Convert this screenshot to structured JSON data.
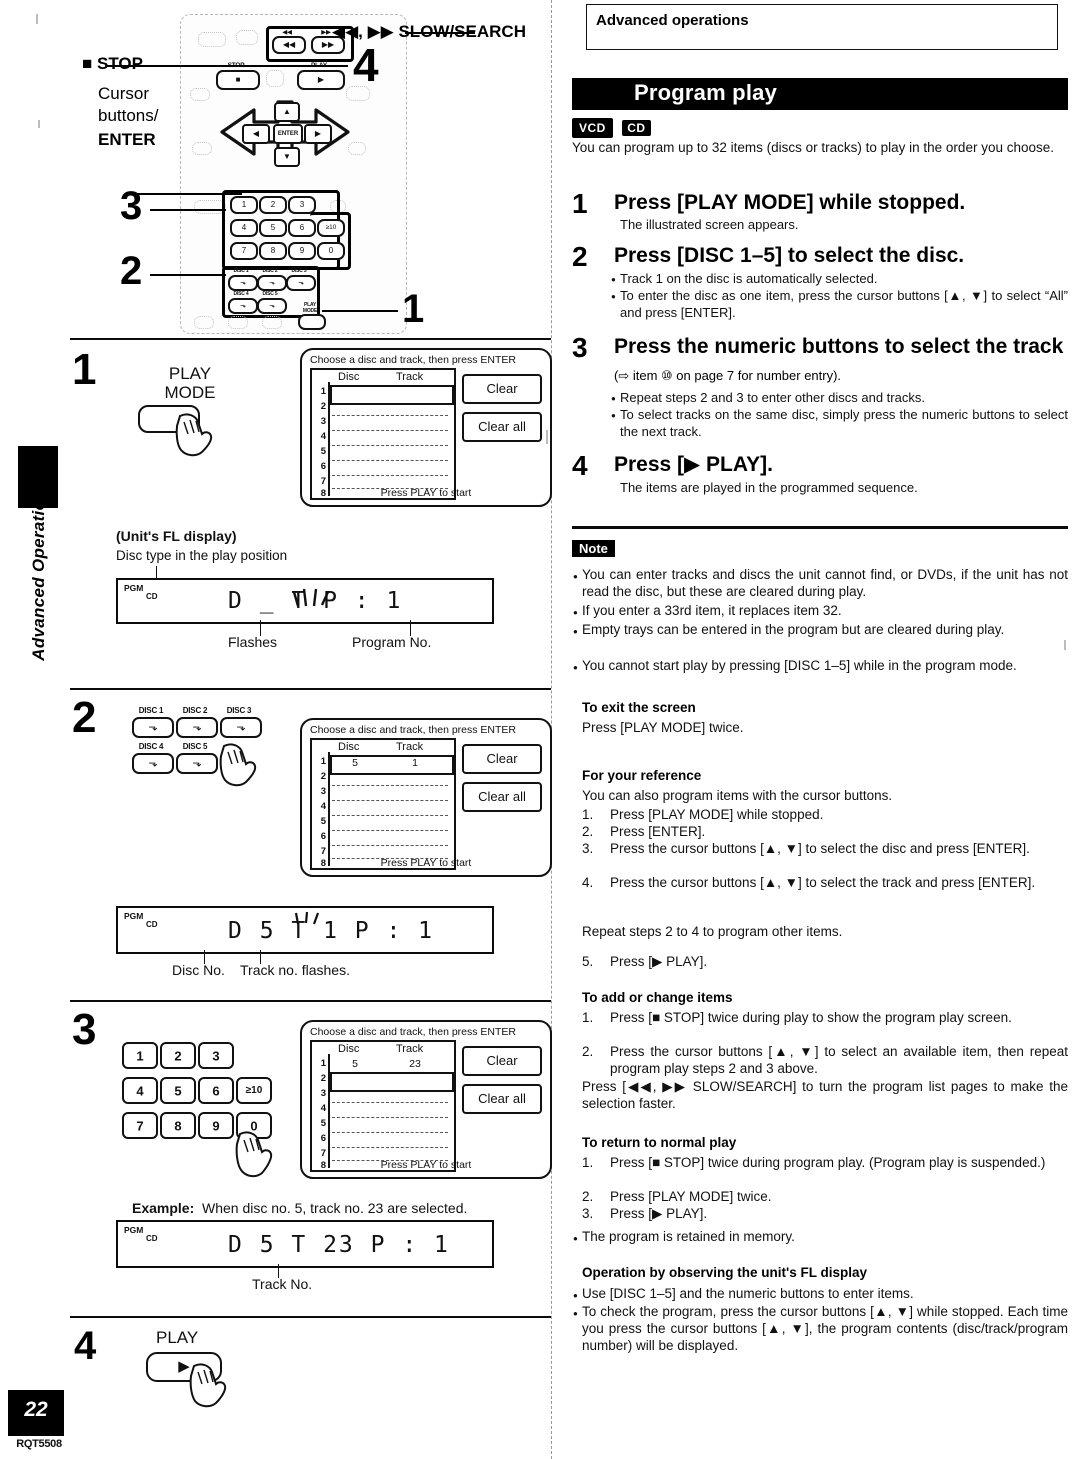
{
  "page": {
    "number": "22",
    "code": "RQT5508",
    "side_tab": "Advanced Operations"
  },
  "right": {
    "section_box_title": "Advanced operations",
    "band_title": "Program play",
    "media_badges": [
      "VCD",
      "CD"
    ],
    "intro": "You can program up to 32 items (discs or tracks) to play in the order you choose.",
    "steps": [
      {
        "num": "1",
        "head": "Press [PLAY MODE] while stopped.",
        "sub": "The illustrated screen appears.",
        "bullets": []
      },
      {
        "num": "2",
        "head": "Press [DISC 1–5] to select the disc.",
        "sub": "",
        "bullets": [
          "Track 1 on the disc is automatically selected.",
          "To enter the disc as one item, press the cursor buttons [▲, ▼] to select “All” and press [ENTER]."
        ]
      },
      {
        "num": "3",
        "head": "Press the numeric buttons to select the track",
        "head_tail": " (⇨ item ⑩ on page 7 for number entry).",
        "sub": "",
        "bullets": [
          "Repeat steps 2 and 3 to enter other discs and tracks.",
          "To select tracks on the same disc, simply press the numeric buttons to select the next track."
        ]
      },
      {
        "num": "4",
        "head": "Press [▶ PLAY].",
        "sub": "The items are played in the programmed sequence.",
        "bullets": []
      }
    ],
    "note_label": "Note",
    "note_bullets": [
      "You can enter tracks and discs the unit cannot find, or DVDs, if the unit has not read the disc, but these are cleared during play.",
      "If you enter a 33rd item, it replaces item 32.",
      "Empty trays can be entered in the program but are cleared during play.",
      "You cannot start play by pressing [DISC 1–5] while in the program mode."
    ],
    "to_exit": {
      "heading": "To exit the screen",
      "body": "Press [PLAY MODE] twice."
    },
    "for_reference": {
      "heading": "For your reference",
      "intro": "You can also program items with the cursor buttons.",
      "items": [
        "Press [PLAY MODE] while stopped.",
        "Press [ENTER].",
        "Press the cursor buttons [▲, ▼] to select the disc and press [ENTER].",
        "Press the cursor buttons [▲, ▼] to select the track and press [ENTER]."
      ],
      "repeat_line": "Repeat steps 2 to 4 to program other items.",
      "item5": "Press [▶ PLAY]."
    },
    "add_change": {
      "heading": "To add or change items",
      "items": [
        "Press [■ STOP] twice during play to show the program play screen.",
        "Press the cursor buttons [▲, ▼] to select an available item, then repeat program play steps 2 and 3 above."
      ],
      "tail": "Press [◀◀, ▶▶ SLOW/SEARCH] to turn the program list pages to make the selection faster."
    },
    "return_normal": {
      "heading": "To return to normal play",
      "items": [
        "Press [■ STOP] twice during program play. (Program play is suspended.)",
        "Press [PLAY MODE] twice.",
        "Press [▶ PLAY]."
      ],
      "bullet": "The program is retained in memory."
    },
    "fl_operation": {
      "heading": "Operation by observing the unit's FL display",
      "bullets": [
        "Use [DISC 1–5] and the numeric buttons to enter items.",
        "To check the program, press the cursor buttons [▲, ▼] while stopped. Each time you press the cursor buttons [▲, ▼], the program contents (disc/track/program number) will be displayed."
      ]
    }
  },
  "left": {
    "remote_callouts": {
      "slow_search": "◀◀, ▶▶ SLOW/SEARCH",
      "stop": "■ STOP",
      "cursor_1": "Cursor",
      "cursor_2": "buttons/",
      "enter": "ENTER",
      "num_4": "4",
      "num_3": "3",
      "num_2": "2",
      "num_1": "1"
    },
    "remote_keys": {
      "numeric": [
        "1",
        "2",
        "3",
        "4",
        "5",
        "6",
        "≥10",
        "7",
        "8",
        "9",
        "0"
      ],
      "disc": [
        "DISC 1",
        "DISC 2",
        "DISC 3",
        "DISC 4",
        "DISC 5"
      ],
      "play_mode": "PLAY MODE",
      "enter_key": "ENTER"
    },
    "steps": [
      {
        "num": "1",
        "button_label_1": "PLAY",
        "button_label_2": "MODE",
        "osd": {
          "title": "Choose a disc and track, then press ENTER",
          "col_disc": "Disc",
          "col_track": "Track",
          "rows": [
            "1",
            "2",
            "3",
            "4",
            "5",
            "6",
            "7",
            "8"
          ],
          "selected_row": 1,
          "sel_disc": "",
          "sel_track": "",
          "btn_clear": "Clear",
          "btn_clear_all": "Clear all",
          "footer": "Press PLAY to start"
        },
        "fl": {
          "caption": "(Unit's FL display)",
          "above_label": "Disc type in the play position",
          "pgm": "PGM",
          "cd": "CD",
          "segments": "D _   T         P : 1",
          "label_flashes": "Flashes",
          "label_program_no": "Program No."
        }
      },
      {
        "num": "2",
        "osd": {
          "title": "Choose a disc and track, then press ENTER",
          "col_disc": "Disc",
          "col_track": "Track",
          "rows": [
            "1",
            "2",
            "3",
            "4",
            "5",
            "6",
            "7",
            "8"
          ],
          "selected_row": 1,
          "sel_disc": "5",
          "sel_track": "1",
          "btn_clear": "Clear",
          "btn_clear_all": "Clear all",
          "footer": "Press PLAY to start"
        },
        "fl": {
          "pgm": "PGM",
          "cd": "CD",
          "segments": "D 5   T 1      P : 1",
          "label_disc_no": "Disc No.",
          "label_track_flashes": "Track no. flashes."
        }
      },
      {
        "num": "3",
        "osd": {
          "title": "Choose a disc and track, then press ENTER",
          "col_disc": "Disc",
          "col_track": "Track",
          "rows": [
            "1",
            "2",
            "3",
            "4",
            "5",
            "6",
            "7",
            "8"
          ],
          "selected_row": 2,
          "sel_disc": "5",
          "sel_track": "23",
          "btn_clear": "Clear",
          "btn_clear_all": "Clear all",
          "footer": "Press PLAY to start"
        },
        "example_label": "Example:",
        "example_text": "When disc no. 5, track no. 23 are selected.",
        "fl": {
          "pgm": "PGM",
          "cd": "CD",
          "segments": "D 5   T 23     P : 1",
          "label_track_no": "Track No."
        }
      },
      {
        "num": "4",
        "button_label_1": "PLAY",
        "button_glyph": "▶"
      }
    ]
  }
}
